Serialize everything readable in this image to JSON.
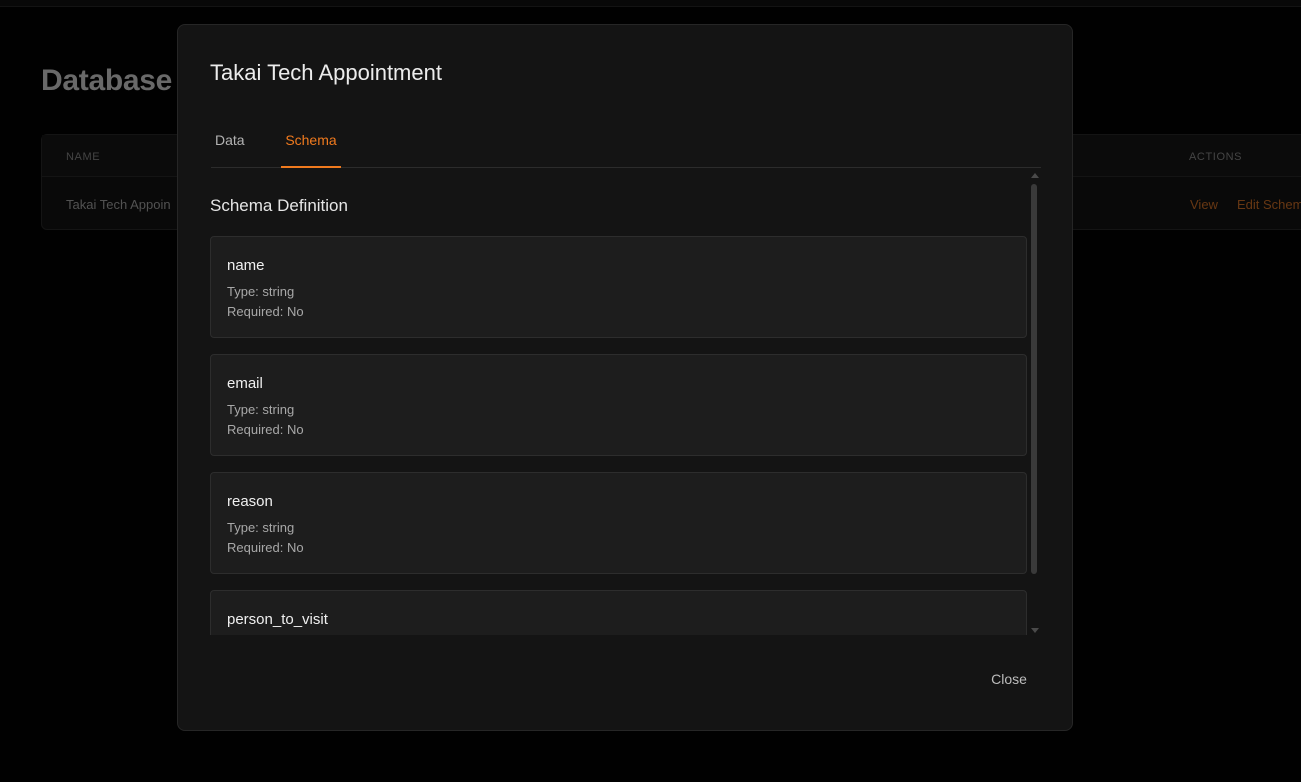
{
  "background": {
    "page_title": "Database",
    "table": {
      "columns": {
        "name": "NAME",
        "actions": "ACTIONS"
      },
      "row": {
        "name": "Takai Tech Appoin",
        "view": "View",
        "edit": "Edit Schem"
      }
    }
  },
  "modal": {
    "title": "Takai Tech Appointment",
    "tabs": [
      {
        "label": "Data",
        "active": false
      },
      {
        "label": "Schema",
        "active": true
      }
    ],
    "section_title": "Schema Definition",
    "fields": [
      {
        "name": "name",
        "type": "Type: string",
        "required": "Required: No"
      },
      {
        "name": "email",
        "type": "Type: string",
        "required": "Required: No"
      },
      {
        "name": "reason",
        "type": "Type: string",
        "required": "Required: No"
      },
      {
        "name": "person_to_visit",
        "type": "",
        "required": ""
      }
    ],
    "close_label": "Close"
  },
  "colors": {
    "accent": "#f07a1e",
    "modal_bg": "#141414",
    "card_bg": "#1d1d1d"
  }
}
